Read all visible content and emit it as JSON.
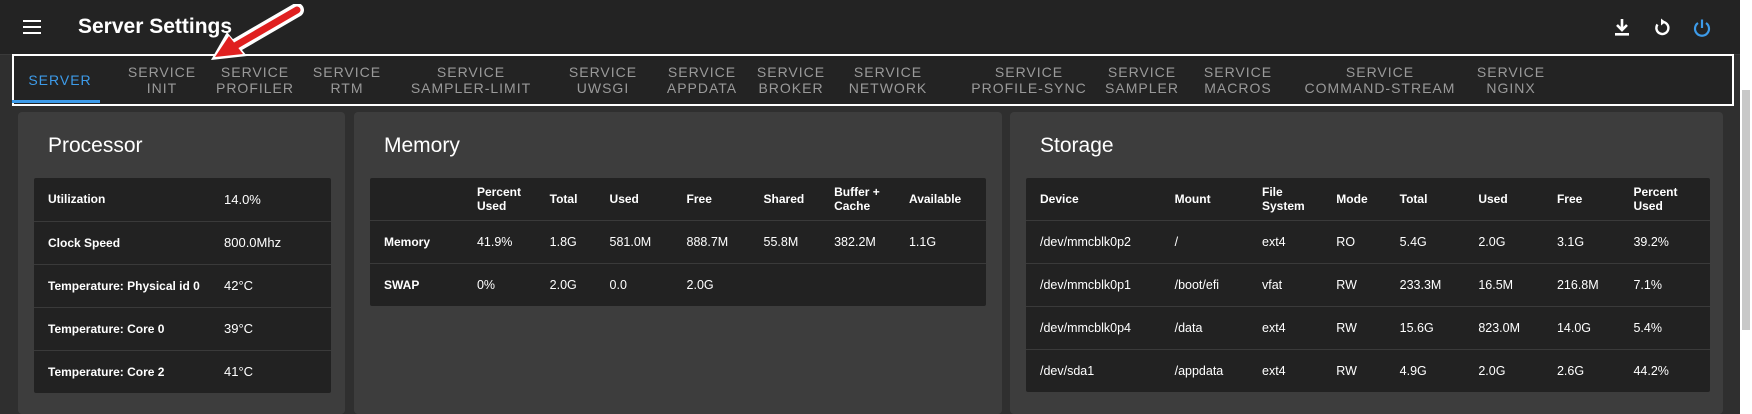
{
  "app": {
    "title": "Server Settings"
  },
  "actions": [
    "download-icon",
    "restart-icon",
    "power-icon"
  ],
  "tabs": [
    [
      "SERVER"
    ],
    [
      "SERVICE",
      "INIT"
    ],
    [
      "SERVICE",
      "PROFILER"
    ],
    [
      "SERVICE",
      "RTM"
    ],
    [
      "SERVICE",
      "SAMPLER-LIMIT"
    ],
    [
      "SERVICE",
      "UWSGI"
    ],
    [
      "SERVICE",
      "APPDATA"
    ],
    [
      "SERVICE",
      "BROKER"
    ],
    [
      "SERVICE",
      "NETWORK"
    ],
    [
      "SERVICE",
      "PROFILE-SYNC"
    ],
    [
      "SERVICE",
      "SAMPLER"
    ],
    [
      "SERVICE",
      "MACROS"
    ],
    [
      "SERVICE",
      "COMMAND-STREAM"
    ],
    [
      "SERVICE",
      "NGINX"
    ]
  ],
  "active_tab": 0,
  "processor": {
    "title": "Processor",
    "rows": [
      {
        "label": "Utilization",
        "value": "14.0%"
      },
      {
        "label": "Clock Speed",
        "value": "800.0Mhz"
      },
      {
        "label": "Temperature: Physical id 0",
        "value": "42°C"
      },
      {
        "label": "Temperature: Core 0",
        "value": "39°C"
      },
      {
        "label": "Temperature: Core 2",
        "value": "41°C"
      }
    ]
  },
  "memory": {
    "title": "Memory",
    "headers": [
      "",
      "Percent\nUsed",
      "Total",
      "Used",
      "Free",
      "Shared",
      "Buffer +\nCache",
      "Available"
    ],
    "rows": [
      [
        "Memory",
        "41.9%",
        "1.8G",
        "581.0M",
        "888.7M",
        "55.8M",
        "382.2M",
        "1.1G"
      ],
      [
        "SWAP",
        "0%",
        "2.0G",
        "0.0",
        "2.0G",
        "",
        "",
        ""
      ]
    ]
  },
  "storage": {
    "title": "Storage",
    "headers": [
      "Device",
      "Mount",
      "File\nSystem",
      "Mode",
      "Total",
      "Used",
      "Free",
      "Percent\nUsed"
    ],
    "rows": [
      [
        "/dev/mmcblk0p2",
        "/",
        "ext4",
        "RO",
        "5.4G",
        "2.0G",
        "3.1G",
        "39.2%"
      ],
      [
        "/dev/mmcblk0p1",
        "/boot/efi",
        "vfat",
        "RW",
        "233.3M",
        "16.5M",
        "216.8M",
        "7.1%"
      ],
      [
        "/dev/mmcblk0p4",
        "/data",
        "ext4",
        "RW",
        "15.6G",
        "823.0M",
        "14.0G",
        "5.4%"
      ],
      [
        "/dev/sda1",
        "/appdata",
        "ext4",
        "RW",
        "4.9G",
        "2.0G",
        "2.6G",
        "44.2%"
      ]
    ]
  },
  "colors": {
    "accent": "#3d9be9",
    "annotation": "#e02020"
  }
}
